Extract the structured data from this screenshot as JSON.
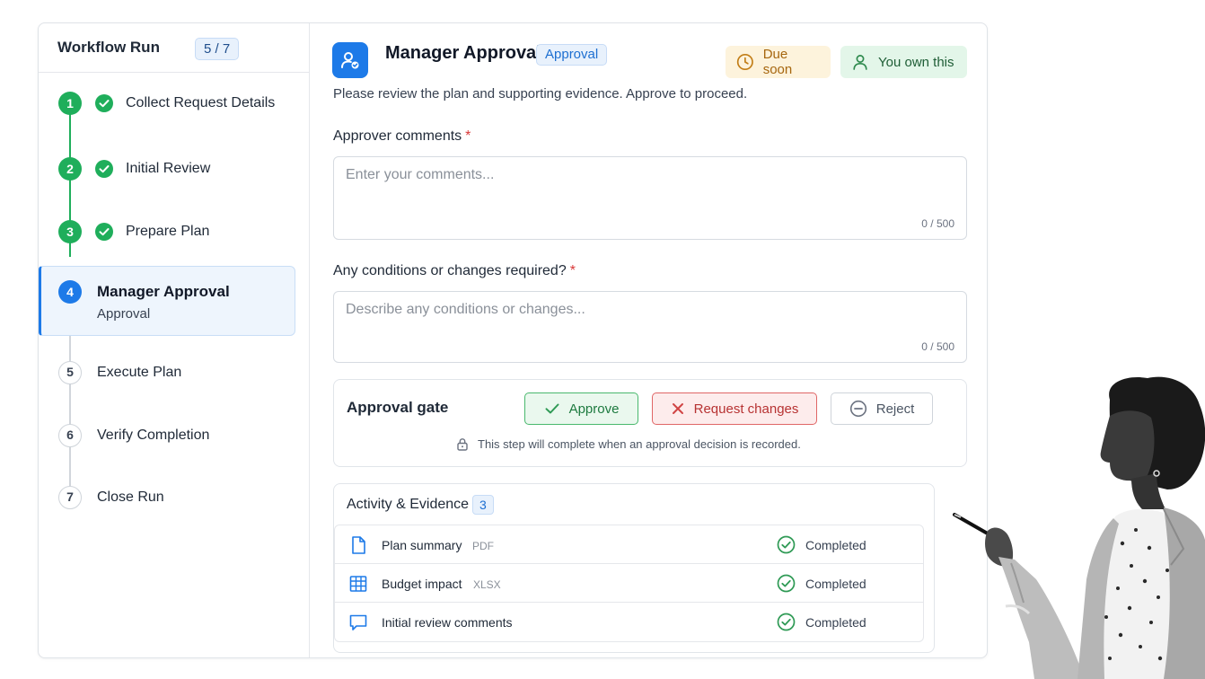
{
  "sidebar": {
    "title": "Workflow Run",
    "progress": "5 / 7",
    "steps": [
      {
        "number": "1",
        "label": "Collect Request Details",
        "state": "completed"
      },
      {
        "number": "2",
        "label": "Initial Review",
        "state": "completed"
      },
      {
        "number": "3",
        "label": "Prepare Plan",
        "state": "completed"
      },
      {
        "number": "4",
        "label": "Manager Approval",
        "sublabel": "Approval",
        "state": "active"
      },
      {
        "number": "5",
        "label": "Execute Plan",
        "state": "pending"
      },
      {
        "number": "6",
        "label": "Verify Completion",
        "state": "pending"
      },
      {
        "number": "7",
        "label": "Close Run",
        "state": "pending"
      }
    ]
  },
  "main": {
    "title": "Manager Approval",
    "type_badge": "Approval",
    "due_badge": "Due soon",
    "owner_badge": "You own this",
    "instructions": "Please review the plan and supporting evidence. Approve to proceed.",
    "comments": {
      "label": "Approver comments",
      "required_mark": "*",
      "placeholder": "Enter your comments...",
      "value": "",
      "counter": "0 / 500"
    },
    "conditions": {
      "label": "Any conditions or changes required?",
      "required_mark": "*",
      "placeholder": "Describe any conditions or changes...",
      "value": "",
      "counter": "0 / 500"
    },
    "gate": {
      "title": "Approval gate",
      "approve_label": "Approve",
      "request_changes_label": "Request changes",
      "reject_label": "Reject",
      "note": "This step will complete when an approval decision is recorded."
    },
    "activity": {
      "title": "Activity & Evidence",
      "count": "3",
      "items": [
        {
          "name": "Plan summary",
          "ext": "PDF",
          "icon": "document-icon",
          "status": "Completed"
        },
        {
          "name": "Budget impact",
          "ext": "XLSX",
          "icon": "spreadsheet-icon",
          "status": "Completed"
        },
        {
          "name": "Initial review comments",
          "ext": "",
          "icon": "comment-icon",
          "status": "Completed"
        }
      ]
    }
  },
  "colors": {
    "accent": "#1d7ae8",
    "success": "#1fae5b",
    "danger": "#d93838",
    "warning": "#a6660e"
  }
}
